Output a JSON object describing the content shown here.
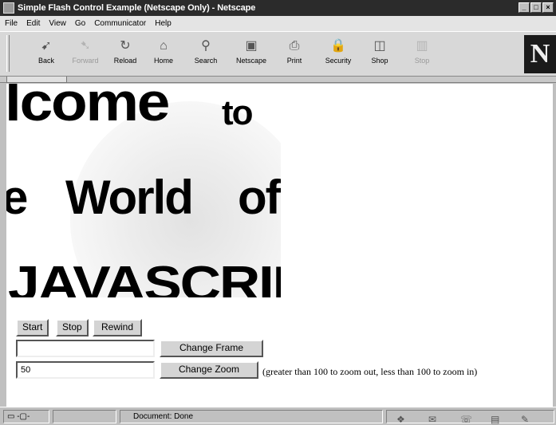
{
  "window": {
    "title": "Simple Flash Control Example (Netscape Only) - Netscape",
    "controls": [
      "_",
      "□",
      "×"
    ]
  },
  "menu": [
    "File",
    "Edit",
    "View",
    "Go",
    "Communicator",
    "Help"
  ],
  "toolbar": {
    "buttons": [
      {
        "label": "Back",
        "icon": "back-arrow-icon",
        "glyph": "➹",
        "enabled": true
      },
      {
        "label": "Forward",
        "icon": "forward-arrow-icon",
        "glyph": "➷",
        "enabled": false
      },
      {
        "label": "Reload",
        "icon": "reload-icon",
        "glyph": "↻",
        "enabled": true
      },
      {
        "label": "Home",
        "icon": "home-icon",
        "glyph": "⌂",
        "enabled": true
      },
      {
        "label": "Search",
        "icon": "search-icon",
        "glyph": "⚲",
        "enabled": true
      },
      {
        "label": "Netscape",
        "icon": "netscape-icon",
        "glyph": "▣",
        "enabled": true
      },
      {
        "label": "Print",
        "icon": "print-icon",
        "glyph": "⎙",
        "enabled": true
      },
      {
        "label": "Security",
        "icon": "lock-icon",
        "glyph": "🔒",
        "enabled": true
      },
      {
        "label": "Shop",
        "icon": "shopping-bag-icon",
        "glyph": "◫",
        "enabled": true
      },
      {
        "label": "Stop",
        "icon": "stop-icon",
        "glyph": "▥",
        "enabled": false
      }
    ],
    "logo": "N"
  },
  "flash": {
    "line1": "lcome",
    "line1b": "to",
    "line2": "e",
    "line2a": "World",
    "line2b": "of",
    "line3": "JAVASCRIF"
  },
  "controls": {
    "start": "Start",
    "stop": "Stop",
    "rewind": "Rewind",
    "frame_value": "",
    "change_frame": "Change Frame",
    "zoom_value": "50",
    "change_zoom": "Change Zoom",
    "zoom_hint": "(greater than 100 to zoom out, less than 100 to zoom in)"
  },
  "status": {
    "text": "Document: Done"
  }
}
